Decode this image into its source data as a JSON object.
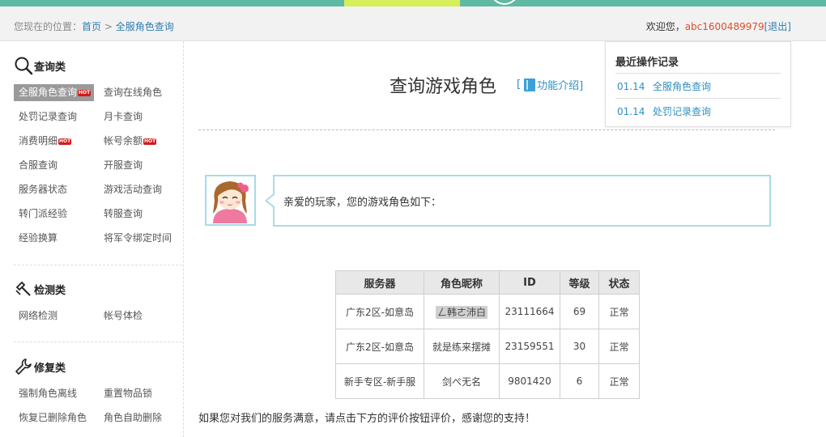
{
  "breadcrumb": {
    "prefix": "您现在的位置：",
    "home": "首页",
    "separator": " > ",
    "current": "全服角色查询"
  },
  "header": {
    "welcome": "欢迎您，",
    "username": "abc1600489979",
    "logout": "[退出]"
  },
  "sidebar": {
    "query_section": {
      "title": "查询类",
      "items": [
        {
          "label": "全服角色查询",
          "hot": true,
          "active": true
        },
        {
          "label": "查询在线角色"
        },
        {
          "label": "处罚记录查询"
        },
        {
          "label": "月卡查询"
        },
        {
          "label": "消费明细",
          "hot": true
        },
        {
          "label": "帐号余额",
          "hot": true
        },
        {
          "label": "合服查询"
        },
        {
          "label": "开服查询"
        },
        {
          "label": "服务器状态"
        },
        {
          "label": "游戏活动查询"
        },
        {
          "label": "转门派经验"
        },
        {
          "label": "转服查询"
        },
        {
          "label": "经验换算"
        },
        {
          "label": "将军令绑定时间"
        }
      ]
    },
    "detect_section": {
      "title": "检测类",
      "items": [
        {
          "label": "网络检测"
        },
        {
          "label": "帐号体检"
        }
      ]
    },
    "repair_section": {
      "title": "修复类",
      "items": [
        {
          "label": "强制角色离线"
        },
        {
          "label": "重置物品锁"
        },
        {
          "label": "恢复已删除角色"
        },
        {
          "label": "角色自助删除"
        }
      ]
    },
    "hot_badge": "HOT"
  },
  "main": {
    "title": "查询游戏角色",
    "func_link_open": "[",
    "func_link": "功能介绍]",
    "message": "亲爱的玩家，您的游戏角色如下：",
    "footer_note": "如果您对我们的服务满意，请点击下方的评价按钮评价，感谢您的支持！"
  },
  "recent": {
    "title": "最近操作记录",
    "items": [
      {
        "date": "01.14",
        "label": "全服角色查询"
      },
      {
        "date": "01.14",
        "label": "处罚记录查询"
      }
    ]
  },
  "table": {
    "headers": [
      "服务器",
      "角色昵称",
      "ID",
      "等级",
      "状态"
    ],
    "rows": [
      [
        "广东2区-如意岛",
        "ㄥ韩ㄜ沛白",
        "23111664",
        "69",
        "正常"
      ],
      [
        "广东2区-如意岛",
        "就是练来摆摊",
        "23159551",
        "30",
        "正常"
      ],
      [
        "新手专区-新手服",
        "剑ぺ无名",
        "9801420",
        "6",
        "正常"
      ]
    ]
  },
  "colors": {
    "link": "#2f7fb0",
    "accent_teal": "#5fb9a3",
    "accent_lime": "#d7ef59",
    "bubble_border": "#a8dbe9",
    "hot_badge": "#d31a1a",
    "username": "#e04b2b"
  },
  "icons": {
    "query": "magnifier-icon",
    "detect": "probe-icon",
    "repair": "wrench-icon",
    "func": "book-icon",
    "avatar": "girl-avatar-icon"
  }
}
